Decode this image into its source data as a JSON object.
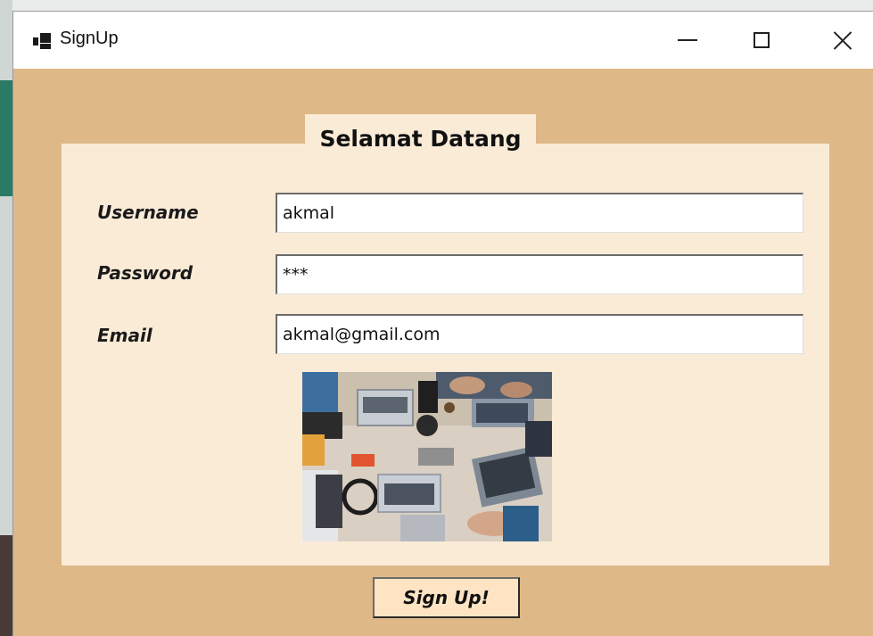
{
  "window": {
    "title": "SignUp",
    "controls": {
      "minimize": "minimize",
      "maximize": "maximize",
      "close": "close"
    }
  },
  "form": {
    "heading": "Selamat Datang",
    "username": {
      "label": "Username",
      "value": "akmal"
    },
    "password": {
      "label": "Password",
      "value": "***"
    },
    "email": {
      "label": "Email",
      "value": "akmal@gmail.com"
    },
    "image": {
      "icon": "office-desk-laptops-photo"
    },
    "submit_label": "Sign Up!"
  },
  "colors": {
    "form_background": "#deb887",
    "panel_background": "#faebd7",
    "button_background": "#ffe4c4",
    "titlebar": "#ffffff"
  }
}
